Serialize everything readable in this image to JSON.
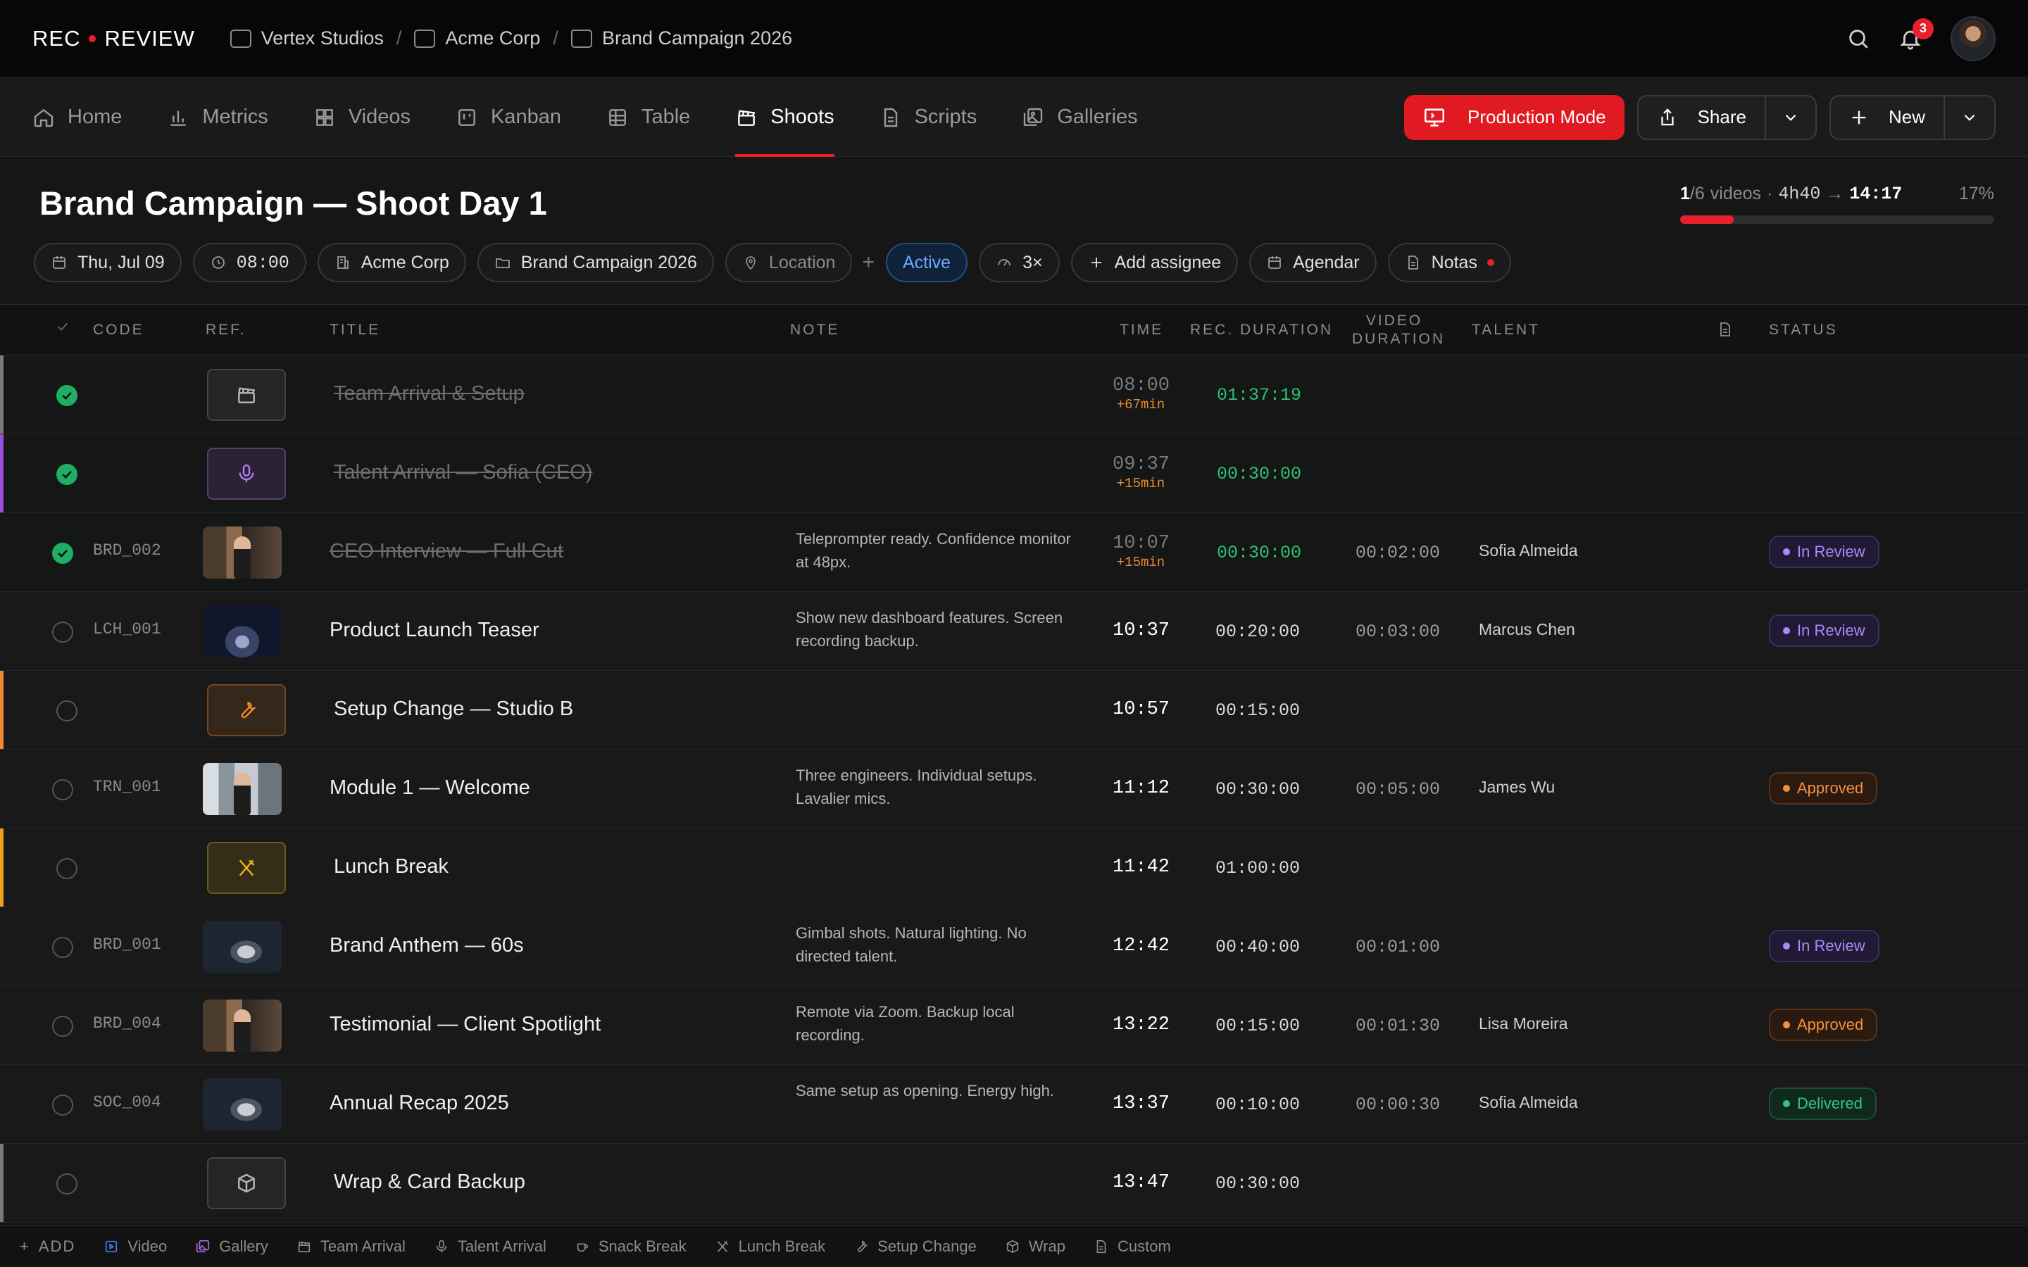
{
  "app": {
    "logo_left": "REC",
    "logo_right": "REVIEW",
    "notification_count": "3"
  },
  "breadcrumbs": [
    "Vertex Studios",
    "Acme Corp",
    "Brand Campaign 2026"
  ],
  "tabs": [
    {
      "label": "Home",
      "icon": "home-icon"
    },
    {
      "label": "Metrics",
      "icon": "bar-chart-icon"
    },
    {
      "label": "Videos",
      "icon": "grid-icon"
    },
    {
      "label": "Kanban",
      "icon": "kanban-icon"
    },
    {
      "label": "Table",
      "icon": "table-icon"
    },
    {
      "label": "Shoots",
      "icon": "clapperboard-icon",
      "active": true
    },
    {
      "label": "Scripts",
      "icon": "document-icon"
    },
    {
      "label": "Galleries",
      "icon": "gallery-icon"
    }
  ],
  "actions": {
    "production_mode": "Production Mode",
    "share": "Share",
    "new": "New"
  },
  "header": {
    "title": "Brand Campaign — Shoot Day 1",
    "progress": {
      "done": "1",
      "total": "/6",
      "unit": "videos",
      "sep": "·",
      "duration": "4h40",
      "end_time": "14:17",
      "percent_label": "17%",
      "fraction": 0.17
    }
  },
  "chips": {
    "date": "Thu, Jul 09",
    "time": "08:00",
    "client": "Acme Corp",
    "project": "Brand Campaign 2026",
    "location": "Location",
    "state": "Active",
    "speed": "3×",
    "assignee": "Add assignee",
    "schedule": "Agendar",
    "notes": "Notas"
  },
  "columns": {
    "code": "CODE",
    "ref": "REF.",
    "title": "TITLE",
    "note": "NOTE",
    "time": "TIME",
    "rec_duration": "REC. DURATION",
    "video_duration_1": "VIDEO",
    "video_duration_2": "DURATION",
    "talent": "TALENT",
    "status": "STATUS"
  },
  "rows": [
    {
      "done": true,
      "code": "",
      "title": "Team Arrival & Setup",
      "note": "",
      "time": "08:00",
      "delay": "+67min",
      "rec": "01:37:19",
      "vdur": "",
      "talent": "",
      "status": "",
      "accent": "#7a7a7a",
      "ref_icon": "clapperboard-icon",
      "ref_color": "#b8b8b8"
    },
    {
      "done": true,
      "code": "",
      "title": "Talent Arrival — Sofia (CEO)",
      "note": "",
      "time": "09:37",
      "delay": "+15min",
      "rec": "00:30:00",
      "vdur": "",
      "talent": "",
      "status": "",
      "accent": "#9b4de0",
      "ref_icon": "microphone-icon",
      "ref_color": "#b07af0"
    },
    {
      "done": true,
      "code": "BRD_002",
      "title": "CEO Interview — Full Cut",
      "note": "Teleprompter ready. Confidence monitor at 48px.",
      "time": "10:07",
      "delay": "+15min",
      "rec": "00:30:00",
      "vdur": "00:02:00",
      "talent": "Sofia Almeida",
      "status": "In Review",
      "thumb": "office"
    },
    {
      "done": false,
      "code": "LCH_001",
      "title": "Product Launch Teaser",
      "note": "Show new dashboard features. Screen recording backup.",
      "time": "10:37",
      "rec": "00:20:00",
      "vdur": "00:03:00",
      "talent": "Marcus Chen",
      "status": "In Review",
      "thumb": "product"
    },
    {
      "done": false,
      "code": "",
      "title": "Setup Change — Studio B",
      "note": "",
      "time": "10:57",
      "rec": "00:15:00",
      "vdur": "",
      "talent": "",
      "status": "",
      "accent": "#f08a2a",
      "ref_icon": "wrench-icon",
      "ref_color": "#f08a2a"
    },
    {
      "done": false,
      "code": "TRN_001",
      "title": "Module 1 — Welcome",
      "note": "Three engineers. Individual setups. Lavalier mics.",
      "time": "11:12",
      "rec": "00:30:00",
      "vdur": "00:05:00",
      "talent": "James Wu",
      "status": "Approved",
      "thumb": "team"
    },
    {
      "done": false,
      "code": "",
      "title": "Lunch Break",
      "note": "",
      "time": "11:42",
      "rec": "01:00:00",
      "vdur": "",
      "talent": "",
      "status": "",
      "accent": "#e8a21a",
      "ref_icon": "utensils-icon",
      "ref_color": "#e8b21a"
    },
    {
      "done": false,
      "code": "BRD_001",
      "title": "Brand Anthem — 60s",
      "note": "Gimbal shots. Natural lighting. No directed talent.",
      "time": "12:42",
      "rec": "00:40:00",
      "vdur": "00:01:00",
      "talent": "",
      "status": "In Review",
      "thumb": "shoe"
    },
    {
      "done": false,
      "code": "BRD_004",
      "title": "Testimonial — Client Spotlight",
      "note": "Remote via Zoom. Backup local recording.",
      "time": "13:22",
      "rec": "00:15:00",
      "vdur": "00:01:30",
      "talent": "Lisa Moreira",
      "status": "Approved",
      "thumb": "office"
    },
    {
      "done": false,
      "code": "SOC_004",
      "title": "Annual Recap 2025",
      "note": "Same setup as opening. Energy high.",
      "time": "13:37",
      "rec": "00:10:00",
      "vdur": "00:00:30",
      "talent": "Sofia Almeida",
      "status": "Delivered",
      "thumb": "shoe"
    },
    {
      "done": false,
      "code": "",
      "title": "Wrap & Card Backup",
      "note": "",
      "time": "13:47",
      "rec": "00:30:00",
      "vdur": "",
      "talent": "",
      "status": "",
      "accent": "#7a7a7a",
      "ref_icon": "box-icon",
      "ref_color": "#b8b8b8"
    }
  ],
  "footer": {
    "add_label": "ADD",
    "items": [
      {
        "label": "Video",
        "icon": "video-icon",
        "color": "#4a7cf0"
      },
      {
        "label": "Gallery",
        "icon": "gallery-icon",
        "color": "#a86ae0"
      },
      {
        "label": "Team Arrival",
        "icon": "clapperboard-icon",
        "color": "#8c8c8c"
      },
      {
        "label": "Talent Arrival",
        "icon": "microphone-icon",
        "color": "#8c8c8c"
      },
      {
        "label": "Snack Break",
        "icon": "cup-icon",
        "color": "#8c8c8c"
      },
      {
        "label": "Lunch Break",
        "icon": "utensils-icon",
        "color": "#8c8c8c"
      },
      {
        "label": "Setup Change",
        "icon": "wrench-icon",
        "color": "#8c8c8c"
      },
      {
        "label": "Wrap",
        "icon": "box-icon",
        "color": "#8c8c8c"
      },
      {
        "label": "Custom",
        "icon": "document-icon",
        "color": "#8c8c8c"
      }
    ]
  }
}
